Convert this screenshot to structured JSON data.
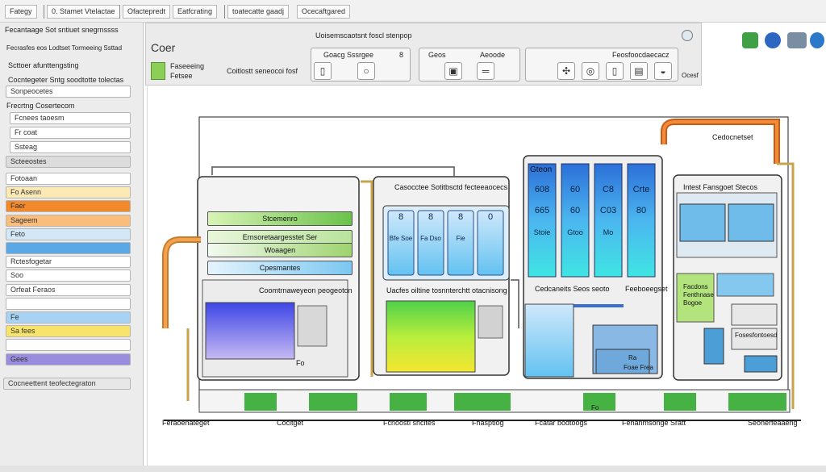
{
  "menubar": {
    "items": [
      "Fategy",
      "0. Stamet Vtelactae",
      "Ofactepredt",
      "Eatfcrating",
      "toatecatte gaadj",
      "Ocecaftgared"
    ]
  },
  "left_panel": {
    "header": "Fecantaage Sot sntiuet snegrnssss",
    "subheader": "Fecrasfes eos Lodtset Tormeeing Ssttad",
    "section1_title": "Scttoer afunttengsting",
    "section1_sub": "Cocntegeter Sntg soodtotte tolectas",
    "section1_row": "Sonpeocetes",
    "section2_title": "Frecrtng Cosertecom",
    "rows_a": [
      "Fcnees taoesm",
      "Fr coat",
      "Ssteag"
    ],
    "section3_title": "Scteeostes",
    "rows_b": [
      {
        "label": "Fotoaan",
        "color": "#ffffff"
      },
      {
        "label": "Fo Asenn",
        "color": "#fde9b4"
      },
      {
        "label": "Faer",
        "color": "#f28a2c"
      },
      {
        "label": "Sageem",
        "color": "#fbbd7c"
      },
      {
        "label": "Feto",
        "color": "#d3e8f7"
      },
      {
        "label": "",
        "color": "#5aa9e6"
      },
      {
        "label": "Rctesfogetar",
        "color": "#ffffff"
      },
      {
        "label": "Soo",
        "color": "#ffffff"
      },
      {
        "label": "Orfeat Feraos",
        "color": "#ffffff"
      },
      {
        "label": "",
        "color": "#ffffff"
      },
      {
        "label": "Fe",
        "color": "#a7d2f3"
      },
      {
        "label": "Sa fees",
        "color": "#f8e46a"
      },
      {
        "label": "",
        "color": "#ffffff"
      },
      {
        "label": "Gees",
        "color": "#9a8de0"
      }
    ],
    "footer": "Cocneettent teofectegraton"
  },
  "toolbar": {
    "title": "Coer",
    "legend_text": [
      "Faseeeing",
      "Fetsee"
    ],
    "legend_caption": "Coitlostt seneocoi fosf",
    "center_title": "Uoisemscaotsnt foscl stenpop",
    "group1_label": "Goacg Sssrgee",
    "group1_value": "8",
    "group2_label": "Geos",
    "group2_value": "Aeoode",
    "group3_label": "Feosfoocdaecacz",
    "right_caption": "Ocesf",
    "icons": [
      "document-icon",
      "magnify-icon",
      "lock-icon",
      "pipe-icon",
      "puzzle-icon",
      "ring-icon",
      "cylinder-icon",
      "door-icon",
      "car-icon",
      "tag-icon"
    ]
  },
  "diagram": {
    "panel_gauges": [
      "Stcemenro",
      "Ernsoretaargesstet Ser",
      "Woaagen",
      "Cpesmantes"
    ],
    "panel_bottom": "Fo",
    "section_left": "Coomtrnaweyeon peogeoton",
    "section_mid_title": "Casocctee Sotitbsctd fecteeaocecs",
    "section_mid_bottom": "Uacfes oiltine tosnnterchtt otacnisong",
    "tanks_small": [
      "8",
      "8",
      "8",
      "0"
    ],
    "tank_small_subs": [
      "Bfe Soe",
      "Fa Dso",
      "Fie",
      ""
    ],
    "section_right_title": "Gteon",
    "tanks_large": [
      "608",
      "60",
      "C8",
      "Crte"
    ],
    "tanks_large_b": [
      "665",
      "60",
      "C03",
      "80"
    ],
    "tanks_large_c": [
      "Stoie",
      "Gtoo",
      "Mo"
    ],
    "label_colossus": "Cedcaneits Seos seoto",
    "label_rebootest": "Feeboeegset",
    "label_right_top": "Intest Fansgoet Stecos",
    "label_right_detail": [
      "Facdons",
      "Fenthnase",
      "Bogoe"
    ],
    "label_right_bottom": "Fosesfontoesd",
    "label_top_right": "Cedocnetset",
    "label_center_small": [
      "Ra",
      "Foae Frea"
    ],
    "bottom_labels": [
      "Feraoenateget",
      "Cocitget",
      "Fcnoostl shcites",
      "Fhasptlog",
      "Fcatar bodtoogs",
      "Fenanmsonge Sratt",
      "Seonerfeaaeng"
    ],
    "small_block_label": "Fo"
  }
}
